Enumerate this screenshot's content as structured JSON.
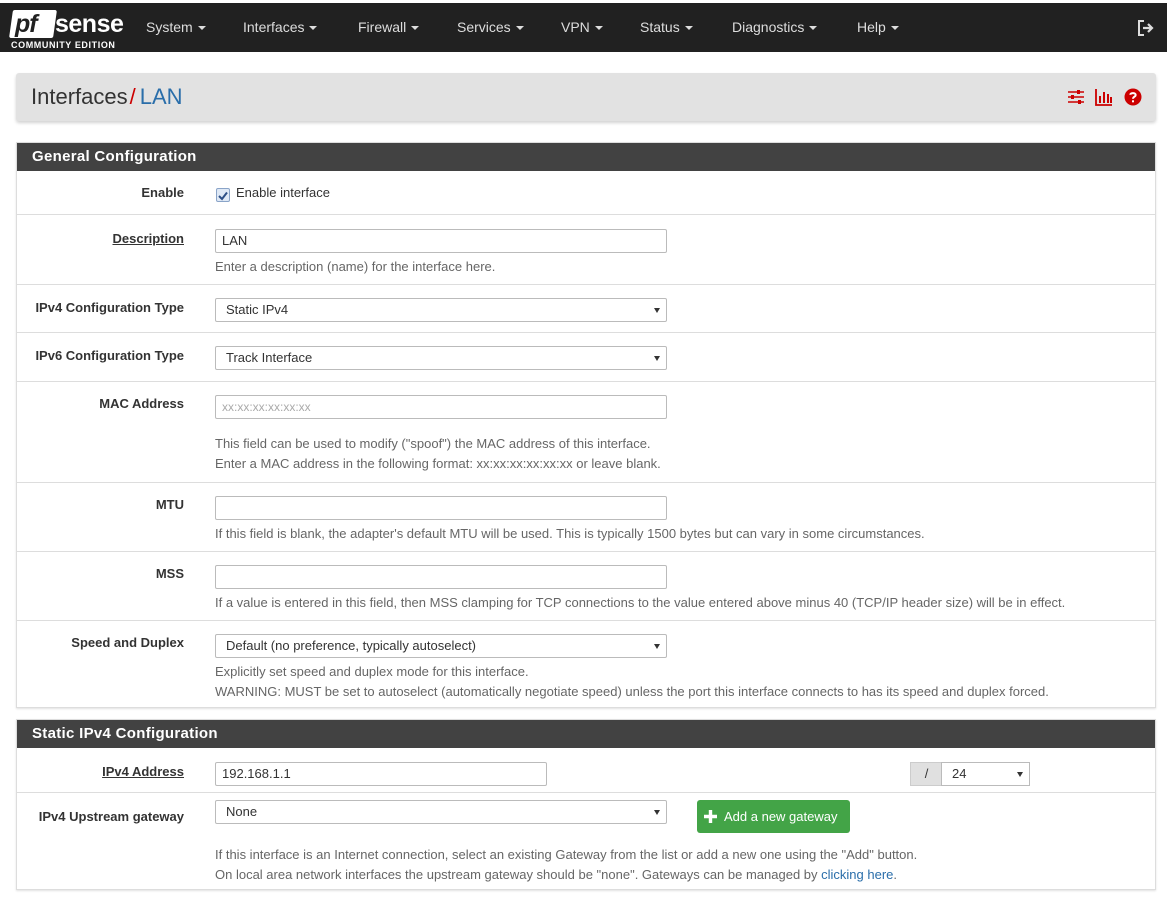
{
  "brand": {
    "logo_left": "pf",
    "logo_right": "sense",
    "edition": "COMMUNITY EDITION"
  },
  "nav": {
    "items": [
      "System",
      "Interfaces",
      "Firewall",
      "Services",
      "VPN",
      "Status",
      "Diagnostics",
      "Help"
    ]
  },
  "header": {
    "section": "Interfaces",
    "separator": "/",
    "current": "LAN"
  },
  "general": {
    "title": "General Configuration",
    "enable_label": "Enable",
    "enable_checkbox_label": "Enable interface",
    "enable_checked": true,
    "description_label": "Description",
    "description_value": "LAN",
    "description_help": "Enter a description (name) for the interface here.",
    "ipv4_type_label": "IPv4 Configuration Type",
    "ipv4_type_value": "Static IPv4",
    "ipv6_type_label": "IPv6 Configuration Type",
    "ipv6_type_value": "Track Interface",
    "mac_label": "MAC Address",
    "mac_placeholder": "xx:xx:xx:xx:xx:xx",
    "mac_help_1": "This field can be used to modify (\"spoof\") the MAC address of this interface.",
    "mac_help_2": "Enter a MAC address in the following format: xx:xx:xx:xx:xx:xx or leave blank.",
    "mtu_label": "MTU",
    "mtu_help": "If this field is blank, the adapter's default MTU will be used. This is typically 1500 bytes but can vary in some circumstances.",
    "mss_label": "MSS",
    "mss_help": "If a value is entered in this field, then MSS clamping for TCP connections to the value entered above minus 40 (TCP/IP header size) will be in effect.",
    "speed_label": "Speed and Duplex",
    "speed_value": "Default (no preference, typically autoselect)",
    "speed_help_1": "Explicitly set speed and duplex mode for this interface.",
    "speed_help_2": "WARNING: MUST be set to autoselect (automatically negotiate speed) unless the port this interface connects to has its speed and duplex forced."
  },
  "static_ipv4": {
    "title": "Static IPv4 Configuration",
    "address_label": "IPv4 Address",
    "address_value": "192.168.1.1",
    "slash": "/",
    "mask_value": "24",
    "gateway_label": "IPv4 Upstream gateway",
    "gateway_value": "None",
    "add_gateway_label": "Add a new gateway",
    "gateway_help_1": "If this interface is an Internet connection, select an existing Gateway from the list or add a new one using the \"Add\" button.",
    "gateway_help_2_prefix": "On local area network interfaces the upstream gateway should be \"none\". Gateways can be managed by ",
    "gateway_help_2_link": "clicking here",
    "gateway_help_2_suffix": "."
  },
  "colors": {
    "navbar": "#212121",
    "panel_heading": "#424242",
    "accent_red": "#c00000",
    "link_blue": "#2a6eaa",
    "button_green": "#43a447"
  }
}
